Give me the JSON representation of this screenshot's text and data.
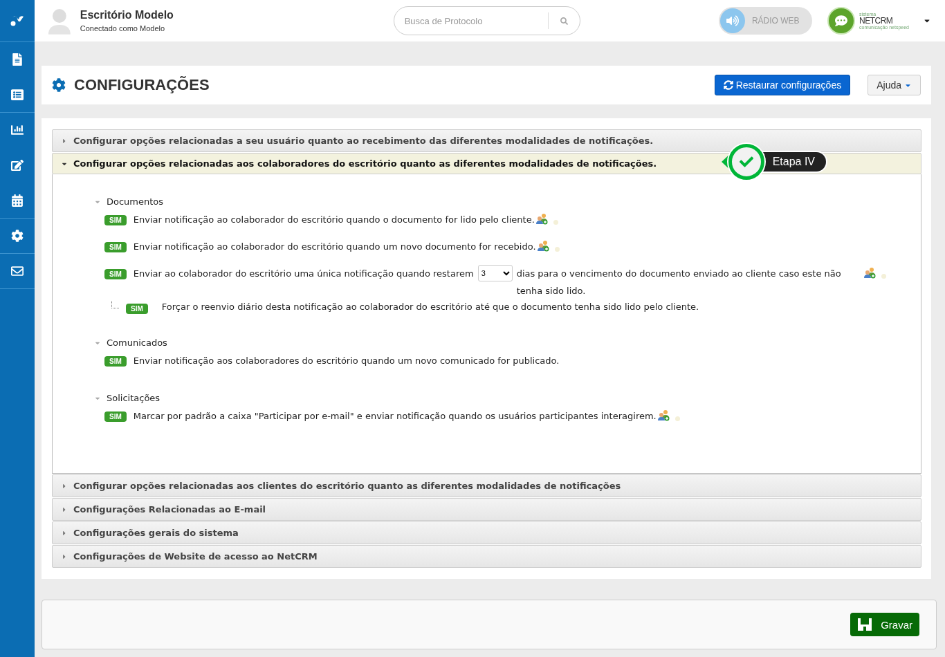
{
  "header": {
    "office_name": "Escritório Modelo",
    "connected_as": "Conectado como Modelo",
    "search": {
      "placeholder": "Busca de Protocolo"
    },
    "radio": {
      "label": "RÁDIO WEB"
    },
    "logo": {
      "top": "sistema",
      "name": "NETCRM",
      "tagline": "comunicação netspeed"
    }
  },
  "sidebar": {
    "items": [
      {
        "kind": "document"
      },
      {
        "kind": "list"
      },
      {
        "kind": "chart"
      },
      {
        "kind": "edit"
      },
      {
        "kind": "calendar"
      },
      {
        "kind": "settings"
      },
      {
        "kind": "mail"
      }
    ]
  },
  "page": {
    "title": "CONFIGURAÇÕES",
    "restore_button": "Restaurar configurações",
    "help_button": "Ajuda"
  },
  "sections": [
    {
      "title": "Configurar opções relacionadas a seu usuário quanto ao recebimento das diferentes modalidades de notificações.",
      "expanded": false
    },
    {
      "title": "Configurar opções relacionadas aos colaboradores do escritório quanto as diferentes modalidades de notificações.",
      "expanded": true,
      "step": "Etapa IV",
      "groups": [
        {
          "title": "Documentos",
          "expanded": true,
          "options": [
            {
              "kind": "plain",
              "badge": "SIM",
              "text": "Enviar notificação ao colaborador do escritório quando o documento for lido pelo cliente.",
              "user_icon": true
            },
            {
              "kind": "plain",
              "badge": "SIM",
              "text": "Enviar notificação ao colaborador do escritório quando um novo documento for recebido.",
              "user_icon": true
            },
            {
              "kind": "select",
              "badge": "SIM",
              "text": "Enviar ao colaborador do escritório uma única notificação quando restarem",
              "value": "3",
              "text_after": "dias para o vencimento do documento enviado ao cliente caso este não tenha sido lido.",
              "user_icon": true,
              "children": [
                {
                  "kind": "plain",
                  "badge": "SIM",
                  "text": "Forçar o reenvio diário desta notificação ao colaborador do escritório até que o documento tenha sido lido pelo cliente.",
                  "user_icon": false
                }
              ]
            }
          ]
        },
        {
          "title": "Comunicados",
          "expanded": true,
          "options": [
            {
              "kind": "plain",
              "badge": "SIM",
              "text": "Enviar notificação aos colaboradores do escritório quando um novo comunicado for publicado.",
              "user_icon": false
            }
          ]
        },
        {
          "title": "Solicitações",
          "expanded": true,
          "options": [
            {
              "kind": "plain",
              "badge": "SIM",
              "text": "Marcar por padrão a caixa \"Participar por e-mail\" e enviar notificação quando os usuários participantes interagirem.",
              "user_icon": true
            }
          ]
        }
      ]
    },
    {
      "title": "Configurar opções relacionadas aos clientes do escritório quanto as diferentes modalidades de notificações",
      "expanded": false
    },
    {
      "title": "Configurações Relacionadas ao E-mail",
      "expanded": false
    },
    {
      "title": "Configurações gerais do sistema",
      "expanded": false
    },
    {
      "title": "Configurações de Website de acesso ao NetCRM",
      "expanded": false
    }
  ],
  "footer": {
    "save_button": "Gravar"
  }
}
